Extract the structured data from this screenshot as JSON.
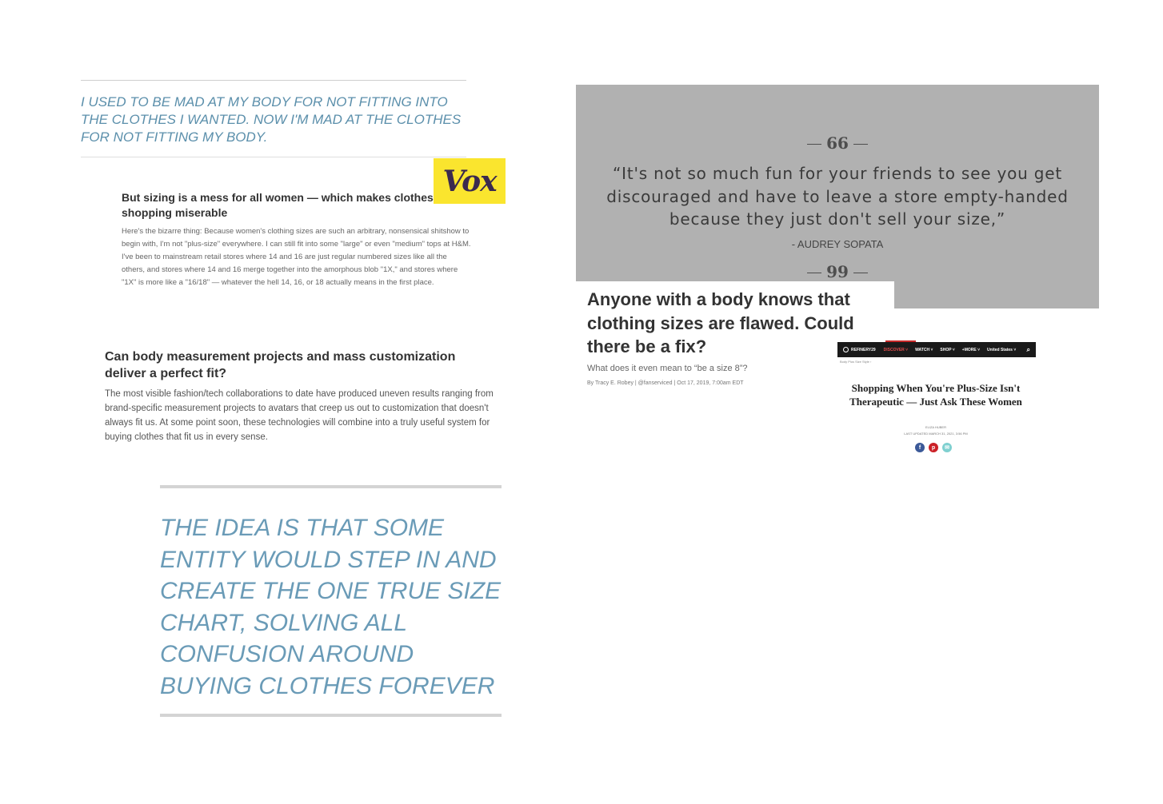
{
  "pull_quote_1": {
    "text": "I used to be mad at my body for not fitting into the clothes I wanted. Now I'm mad at the clothes for not fitting my body."
  },
  "vox": {
    "logo": "Vox",
    "heading": "But sizing is a mess for all women — which makes clothes shopping miserable",
    "body": "Here's the bizarre thing: Because women's clothing sizes are such an arbitrary, nonsensical shitshow to begin with, I'm not \"plus-size\" everywhere. I can still fit into some \"large\" or even \"medium\" tops at H&M. I've been to mainstream retail stores where 14 and 16 are just regular numbered sizes like all the others, and stores where 14 and 16 merge together into the amorphous blob \"1X,\" and stores where \"1X\" is more like a \"16/18\" — whatever the hell 14, 16, or 18 actually means in the first place."
  },
  "body_measurement": {
    "heading": "Can body measurement projects and mass customization deliver a perfect fit?",
    "body": "The most visible fashion/tech collaborations to date have produced uneven results ranging from brand-specific measurement projects to avatars that creep us out to customization that doesn't always fit us. At some point soon, these technologies will combine into a truly useful system for buying clothes that fit us in every sense."
  },
  "pull_quote_2": {
    "text": "The idea is that some entity would step in and create the one true size chart, solving all confusion around buying clothes forever"
  },
  "grey_quote": {
    "open_mark": "66",
    "quote": "“It's not so much fun for your friends to see you get discouraged and have to leave a store empty-handed because they just don't sell your size,”",
    "attribution": "- AUDREY SOPATA",
    "close_mark": "99"
  },
  "article": {
    "title": "Anyone with a body knows that clothing sizes are flawed. Could there be a fix?",
    "subtitle": "What does it even mean to “be a size 8”?",
    "byline": "By Tracy E. Robey | @fanserviced | Oct 17, 2019, 7:00am EDT"
  },
  "refinery29": {
    "brand": "REFINERY29",
    "nav": [
      "DISCOVER ˅",
      "WATCH ˅",
      "SHOP ˅",
      "+MORE ˅",
      "United States ˅"
    ],
    "breadcrumb": "Body  Plus Size Style  ›",
    "title": "Shopping When You're Plus-Size Isn't Therapeutic — Just Ask These Women",
    "author": "ELIZA HUBER",
    "updated": "LAST UPDATED MARCH 31, 2021, 3:56 PM",
    "social": [
      "f",
      "p",
      "✉"
    ],
    "social_colors": [
      "#3b5998",
      "#cb2027",
      "#7fd0d0"
    ]
  }
}
